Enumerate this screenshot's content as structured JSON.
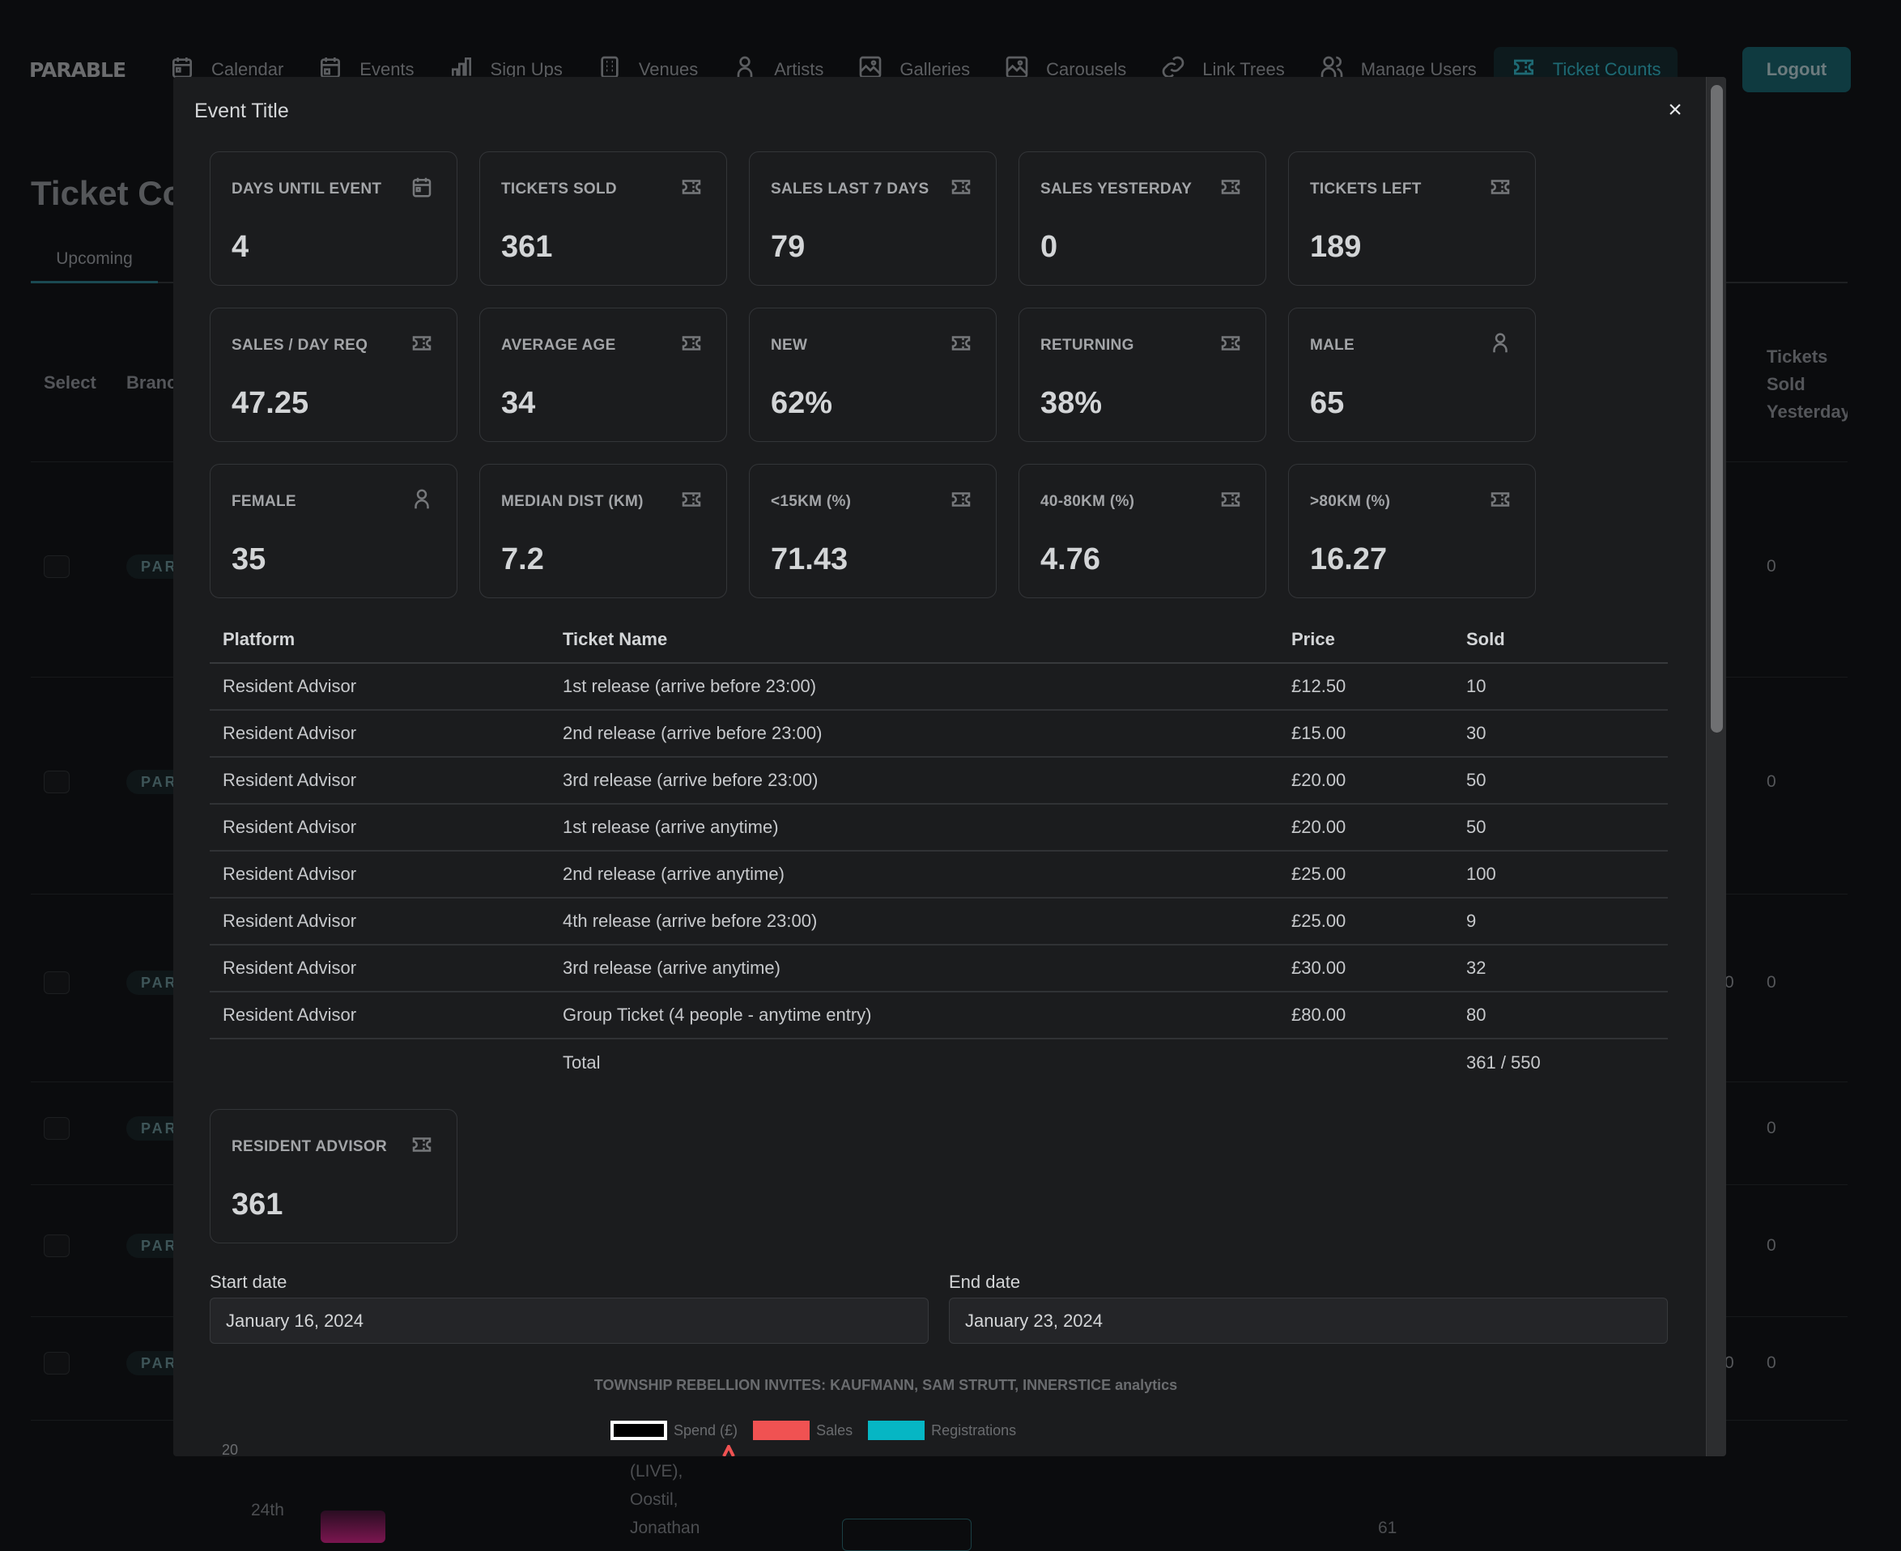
{
  "app": {
    "logo": "PARABLE",
    "nav": [
      {
        "label": "Calendar",
        "icon": "calendar-icon",
        "active": false
      },
      {
        "label": "Events",
        "icon": "calendar-event-icon",
        "active": false
      },
      {
        "label": "Sign Ups",
        "icon": "bar-chart-icon",
        "active": false
      },
      {
        "label": "Venues",
        "icon": "building-icon",
        "active": false
      },
      {
        "label": "Artists",
        "icon": "user-icon",
        "active": false
      },
      {
        "label": "Galleries",
        "icon": "image-icon",
        "active": false
      },
      {
        "label": "Carousels",
        "icon": "image-icon",
        "active": false
      },
      {
        "label": "Link Trees",
        "icon": "link-icon",
        "active": false
      },
      {
        "label": "Manage Users",
        "icon": "users-icon",
        "active": false
      },
      {
        "label": "Ticket Counts",
        "icon": "ticket-icon",
        "active": true
      }
    ],
    "logout_label": "Logout",
    "accent_color": "#0f3a40"
  },
  "background_page": {
    "title": "Ticket Co",
    "tabs": [
      {
        "label": "Upcoming",
        "active": true
      }
    ],
    "columns": {
      "select": "Select",
      "brand": "Branc",
      "tickets_sold_yesterday": "Tickets Sold Yesterday"
    },
    "rows": [
      {
        "badge": "PAR.",
        "sold_yesterday": "0",
        "extra": ""
      },
      {
        "badge": "PAR.",
        "sold_yesterday": "0",
        "extra": ""
      },
      {
        "badge": "PAR.",
        "sold_yesterday": "0",
        "extra": "0"
      },
      {
        "badge": "PAR.",
        "sold_yesterday": "0",
        "extra": ""
      },
      {
        "badge": "PAR.",
        "sold_yesterday": "0",
        "extra": ""
      },
      {
        "badge": "PAR.",
        "sold_yesterday": "0",
        "extra": "0"
      }
    ],
    "partial_row": {
      "date": "24th",
      "lineup": [
        "(LIVE),",
        "Oostil,",
        "Jonathan"
      ],
      "count": "61"
    }
  },
  "modal": {
    "title": "Event Title",
    "close_label": "×",
    "stats": [
      {
        "label": "DAYS UNTIL EVENT",
        "value": "4",
        "icon": "calendar-icon"
      },
      {
        "label": "TICKETS SOLD",
        "value": "361",
        "icon": "ticket-icon"
      },
      {
        "label": "SALES LAST 7 DAYS",
        "value": "79",
        "icon": "ticket-icon"
      },
      {
        "label": "SALES YESTERDAY",
        "value": "0",
        "icon": "ticket-icon"
      },
      {
        "label": "TICKETS LEFT",
        "value": "189",
        "icon": "ticket-icon"
      },
      {
        "label": "SALES / DAY REQ",
        "value": "47.25",
        "icon": "ticket-icon"
      },
      {
        "label": "AVERAGE AGE",
        "value": "34",
        "icon": "ticket-icon"
      },
      {
        "label": "NEW",
        "value": "62%",
        "icon": "ticket-icon"
      },
      {
        "label": "RETURNING",
        "value": "38%",
        "icon": "ticket-icon"
      },
      {
        "label": "MALE",
        "value": "65",
        "icon": "user-icon"
      },
      {
        "label": "FEMALE",
        "value": "35",
        "icon": "user-icon"
      },
      {
        "label": "MEDIAN DIST (KM)",
        "value": "7.2",
        "icon": "ticket-icon"
      },
      {
        "label": "<15KM (%)",
        "value": "71.43",
        "icon": "ticket-icon"
      },
      {
        "label": "40-80KM (%)",
        "value": "4.76",
        "icon": "ticket-icon"
      },
      {
        "label": ">80KM (%)",
        "value": "16.27",
        "icon": "ticket-icon"
      }
    ],
    "table": {
      "headers": [
        "Platform",
        "Ticket Name",
        "Price",
        "Sold"
      ],
      "rows": [
        [
          "Resident Advisor",
          "1st release (arrive before 23:00)",
          "£12.50",
          "10"
        ],
        [
          "Resident Advisor",
          "2nd release (arrive before 23:00)",
          "£15.00",
          "30"
        ],
        [
          "Resident Advisor",
          "3rd release (arrive before 23:00)",
          "£20.00",
          "50"
        ],
        [
          "Resident Advisor",
          "1st release (arrive anytime)",
          "£20.00",
          "50"
        ],
        [
          "Resident Advisor",
          "2nd release (arrive anytime)",
          "£25.00",
          "100"
        ],
        [
          "Resident Advisor",
          "4th release (arrive before 23:00)",
          "£25.00",
          "9"
        ],
        [
          "Resident Advisor",
          "3rd release (arrive anytime)",
          "£30.00",
          "32"
        ],
        [
          "Resident Advisor",
          "Group Ticket (4 people - anytime entry)",
          "£80.00",
          "80"
        ]
      ],
      "total_label": "Total",
      "total_value": "361 / 550"
    },
    "platform_card": {
      "label": "RESIDENT ADVISOR",
      "value": "361",
      "icon": "ticket-icon"
    },
    "start_date": {
      "label": "Start date",
      "value": "January 16, 2024"
    },
    "end_date": {
      "label": "End date",
      "value": "January 23, 2024"
    },
    "chart": {
      "title": "TOWNSHIP REBELLION INVITES: KAUFMANN, SAM STRUTT, INNERSTICE analytics",
      "legend": [
        {
          "label": "Spend (£)",
          "color": "#000000",
          "border": "#ffffff"
        },
        {
          "label": "Sales",
          "color": "#f05252",
          "border": "#f05252"
        },
        {
          "label": "Registrations",
          "color": "#06b6c4",
          "border": "#06b6c4"
        }
      ],
      "y_tick_top": "20"
    }
  }
}
